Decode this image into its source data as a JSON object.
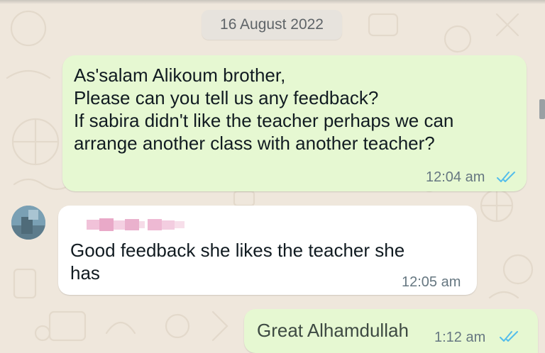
{
  "date_separator": "16 August 2022",
  "messages": [
    {
      "direction": "outgoing",
      "text": "As'salam Alikoum brother,\nPlease can you tell us any feedback?\nIf sabira didn't like the teacher perhaps we can\narrange another class with another teacher?",
      "time": "12:04 am",
      "status": "read-double-tick-icon"
    },
    {
      "direction": "incoming",
      "sender": "blurred-contact-name",
      "text": "Good feedback she likes the teacher she\nhas",
      "time": "12:05 am"
    },
    {
      "direction": "outgoing",
      "text": "Great Alhamdullah",
      "time": "1:12 am",
      "status": "read-double-tick-icon"
    }
  ],
  "colors": {
    "outgoing_bubble": "#e6f8d2",
    "incoming_bubble": "#ffffff",
    "read_ticks": "#53bdeb",
    "wallpaper": "#efe7dc"
  }
}
